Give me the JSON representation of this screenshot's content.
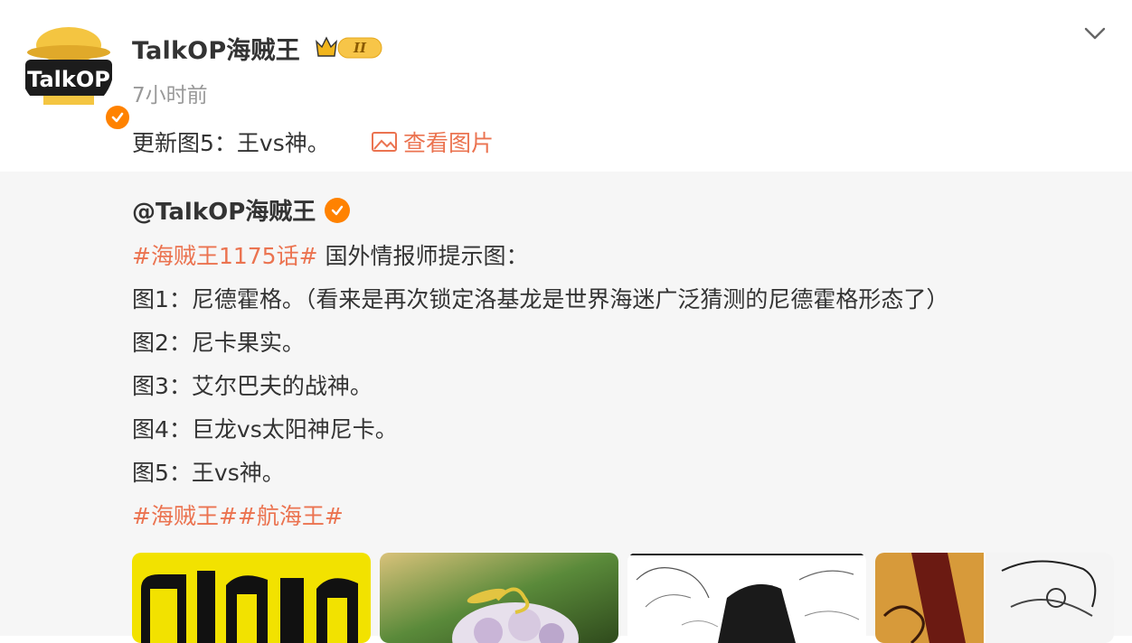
{
  "post": {
    "username": "TalkOP海贼王",
    "member_level": "II",
    "timestamp": "7小时前",
    "text": "更新图5：王vs神。",
    "view_image_label": "查看图片",
    "avatar_text": "TalkOP"
  },
  "repost": {
    "author": "@TalkOP海贼王",
    "lines": [
      {
        "hashtag": "#海贼王1175话#",
        "text": " 国外情报师提示图："
      },
      {
        "text": "图1：尼德霍格。（看来是再次锁定洛基龙是世界海迷广泛猜测的尼德霍格形态了）"
      },
      {
        "text": "图2：尼卡果实。"
      },
      {
        "text": "图3：艾尔巴夫的战神。"
      },
      {
        "text": "图4：巨龙vs太阳神尼卡。"
      },
      {
        "text": "图5：王vs神。"
      }
    ],
    "hashtags": [
      "#海贼王#",
      "#航海王#"
    ]
  },
  "thumbnails": [
    {
      "name": "image-1",
      "desc": "yellow-black"
    },
    {
      "name": "image-2",
      "desc": "devil-fruit"
    },
    {
      "name": "image-3",
      "desc": "manga-sketch"
    },
    {
      "name": "image-4",
      "desc": "dark-panel"
    }
  ],
  "colors": {
    "accent": "#eb7350",
    "verified": "#ff8200",
    "repost_bg": "#f6f6f6",
    "muted": "#999999"
  },
  "icons": [
    "chevron-down-icon",
    "image-icon",
    "verified-icon",
    "crown-icon"
  ]
}
